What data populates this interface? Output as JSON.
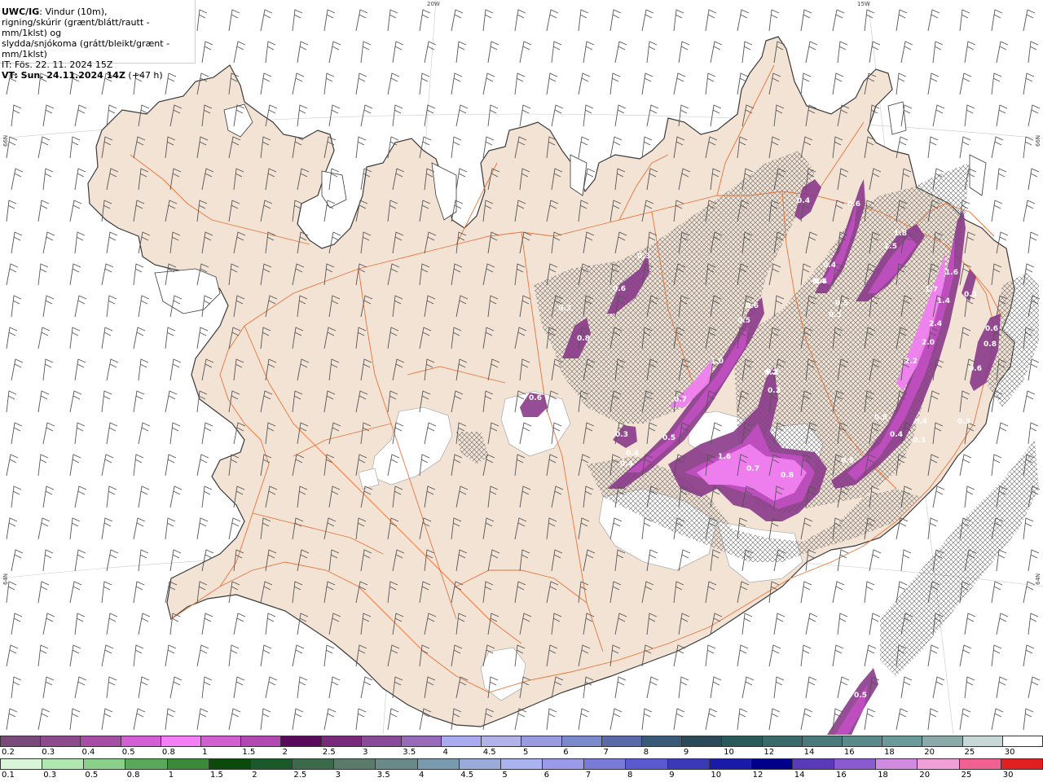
{
  "info": {
    "title_bold": "UWC/IG",
    "title_rest": ": Vindur (10m),",
    "line2": "rigning/skúrir (grænt/blátt/rautt - mm/1klst) og",
    "line3": "slydda/snjókoma (grátt/bleikt/grænt - mm/1klst)",
    "line4": "IT: Fös. 22. 11. 2024 15Z",
    "vt_bold": "VT: Sun. 24.11.2024 14Z",
    "vt_rest": " (+47 h)"
  },
  "coords": {
    "top1": "20W",
    "top2": "15W",
    "left1": "66N",
    "left2": "64N",
    "right1": "66N",
    "right2": "64N"
  },
  "colors": {
    "land": "#f2e3d5",
    "coast": "#3a3a3a",
    "roads": "#e8743a",
    "glacier": "#ffffff",
    "barb": "#555555",
    "precip_light": "#8a3a8a",
    "precip_mid": "#c24fc2",
    "precip_high": "#f080f0"
  },
  "legend_snow": {
    "labels": [
      "0.2",
      "0.3",
      "0.4",
      "0.5",
      "0.8",
      "1",
      "1.5",
      "2",
      "2.5",
      "3",
      "3.5",
      "4",
      "4.5",
      "5",
      "6",
      "7",
      "8",
      "9",
      "10",
      "12",
      "14",
      "16",
      "18",
      "20",
      "25",
      "30"
    ],
    "colors": [
      "#7a4a7a",
      "#8d4a8d",
      "#a64ea6",
      "#d45ed4",
      "#f47ef4",
      "#d060d0",
      "#b248b2",
      "#5a0a5a",
      "#7a2a7a",
      "#8a4a9a",
      "#9a6aba",
      "#aaaaf0",
      "#b2b2ea",
      "#9a9ae0",
      "#7a8acc",
      "#5a6aa8",
      "#3a5a7a",
      "#2a4a5a",
      "#2a5a5a",
      "#3a6a6a",
      "#4a7a7a",
      "#5a8a8a",
      "#6a9a9a",
      "#8aaaaa",
      "#c8d8d8",
      "#ffffff"
    ]
  },
  "legend_rain": {
    "labels": [
      "0.1",
      "0.3",
      "0.5",
      "0.8",
      "1",
      "1.5",
      "2",
      "2.5",
      "3",
      "3.5",
      "4",
      "4.5",
      "5",
      "6",
      "7",
      "8",
      "9",
      "10",
      "12",
      "14",
      "16",
      "18",
      "20",
      "25",
      "30"
    ],
    "colors": [
      "#d8f5d8",
      "#b0e6b0",
      "#8acf8a",
      "#5aa85a",
      "#3a8a3a",
      "#0a4a0a",
      "#1a5a2a",
      "#3a6a4a",
      "#5a7a6a",
      "#6a8a8a",
      "#7a9ab0",
      "#9aaada",
      "#aab2f0",
      "#9a9ae8",
      "#7a7ad8",
      "#5a5ad0",
      "#3a3ab8",
      "#1a1aa8",
      "#00008a",
      "#5a3ab8",
      "#8a5ad0",
      "#d08ae0",
      "#f0a0d8",
      "#f06090",
      "#e02020"
    ]
  },
  "precip_labels": [
    "0.4",
    "0.6",
    "0.3",
    "0.6",
    "0.3",
    "0.8",
    "0.4",
    "0.6",
    "0.5",
    "1.0",
    "0.7",
    "0.4",
    "0.3",
    "0.4",
    "0.5",
    "0.4",
    "1.6",
    "0.7",
    "0.8",
    "0.2",
    "0.2",
    "0.4",
    "0.4",
    "0.5",
    "0.5",
    "1.8",
    "1.5",
    "1.7",
    "1.4",
    "2.4",
    "2.0",
    "2.2",
    "1.6",
    "0.3",
    "0.6",
    "0.8",
    "0.6",
    "0.3",
    "0.5",
    "0.4",
    "0.5",
    "0.3",
    "0.6",
    "0.5",
    "0.2"
  ]
}
